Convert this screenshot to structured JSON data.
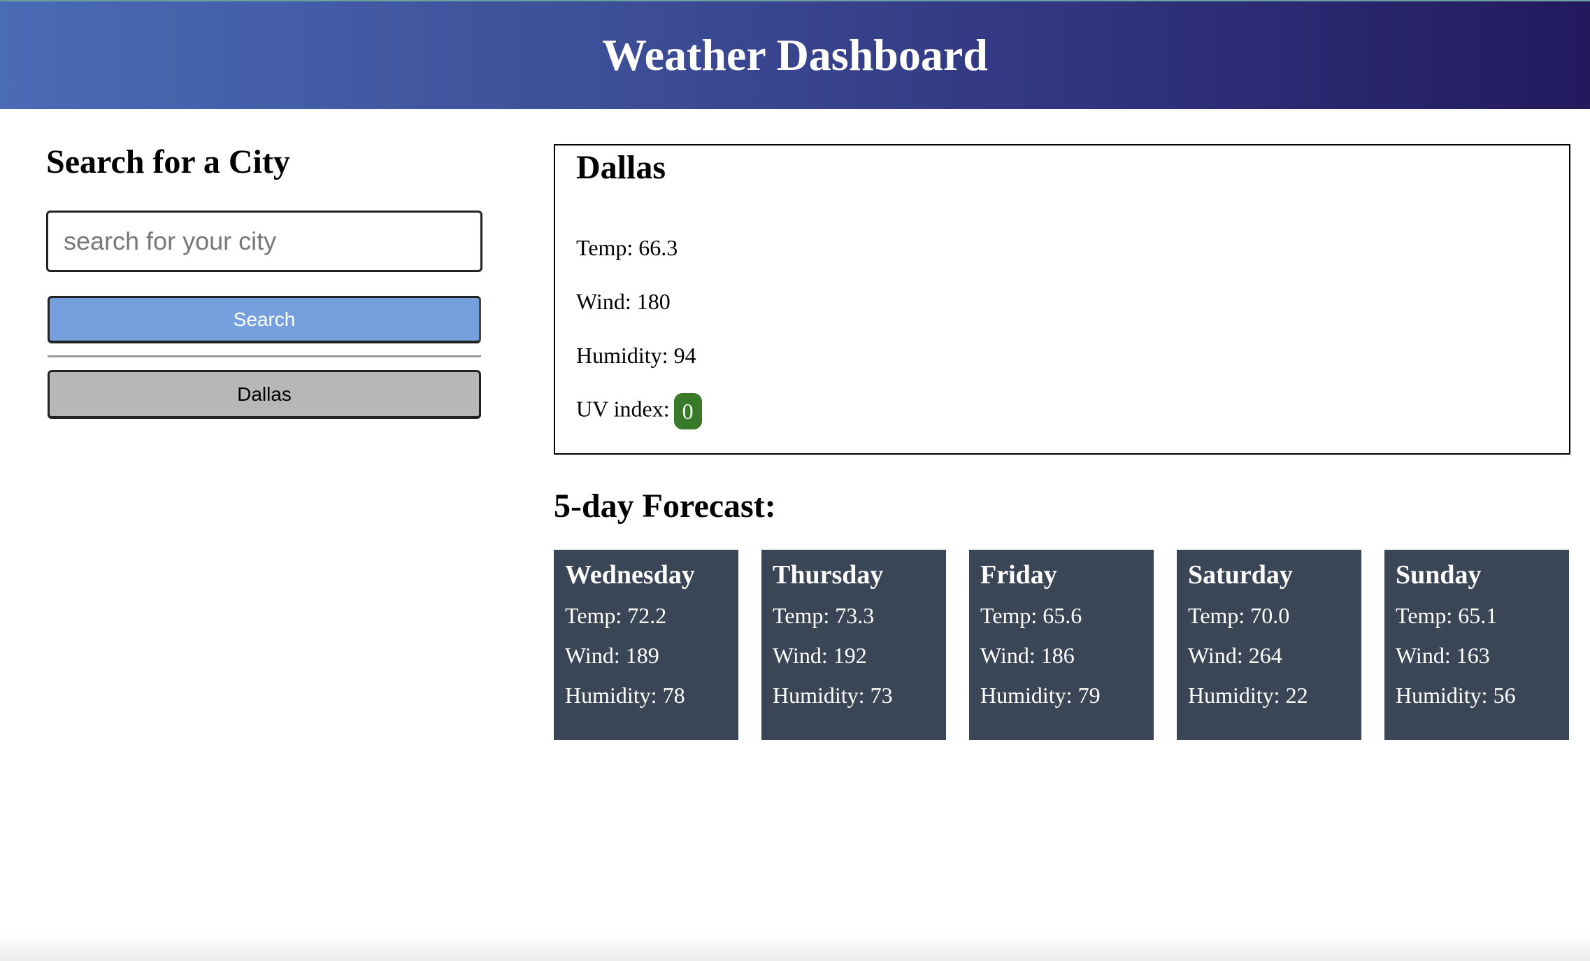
{
  "header": {
    "title": "Weather Dashboard"
  },
  "sidebar": {
    "heading": "Search for a City",
    "search_placeholder": "search for your city",
    "search_value": "",
    "search_button": "Search",
    "history": [
      "Dallas"
    ]
  },
  "current": {
    "city": "Dallas",
    "temp": "Temp: 66.3",
    "wind": "Wind: 180",
    "humidity": "Humidity: 94",
    "uv_label": "UV index:",
    "uv_value": "0",
    "uv_color": "#38792a"
  },
  "forecast": {
    "title": "5-day Forecast:",
    "days": [
      {
        "day": "Wednesday",
        "temp": "Temp: 72.2",
        "wind": "Wind: 189",
        "humidity": "Humidity: 78"
      },
      {
        "day": "Thursday",
        "temp": "Temp: 73.3",
        "wind": "Wind: 192",
        "humidity": "Humidity: 73"
      },
      {
        "day": "Friday",
        "temp": "Temp: 65.6",
        "wind": "Wind: 186",
        "humidity": "Humidity: 79"
      },
      {
        "day": "Saturday",
        "temp": "Temp: 70.0",
        "wind": "Wind: 264",
        "humidity": "Humidity: 22"
      },
      {
        "day": "Sunday",
        "temp": "Temp: 65.1",
        "wind": "Wind: 163",
        "humidity": "Humidity: 56"
      }
    ]
  }
}
